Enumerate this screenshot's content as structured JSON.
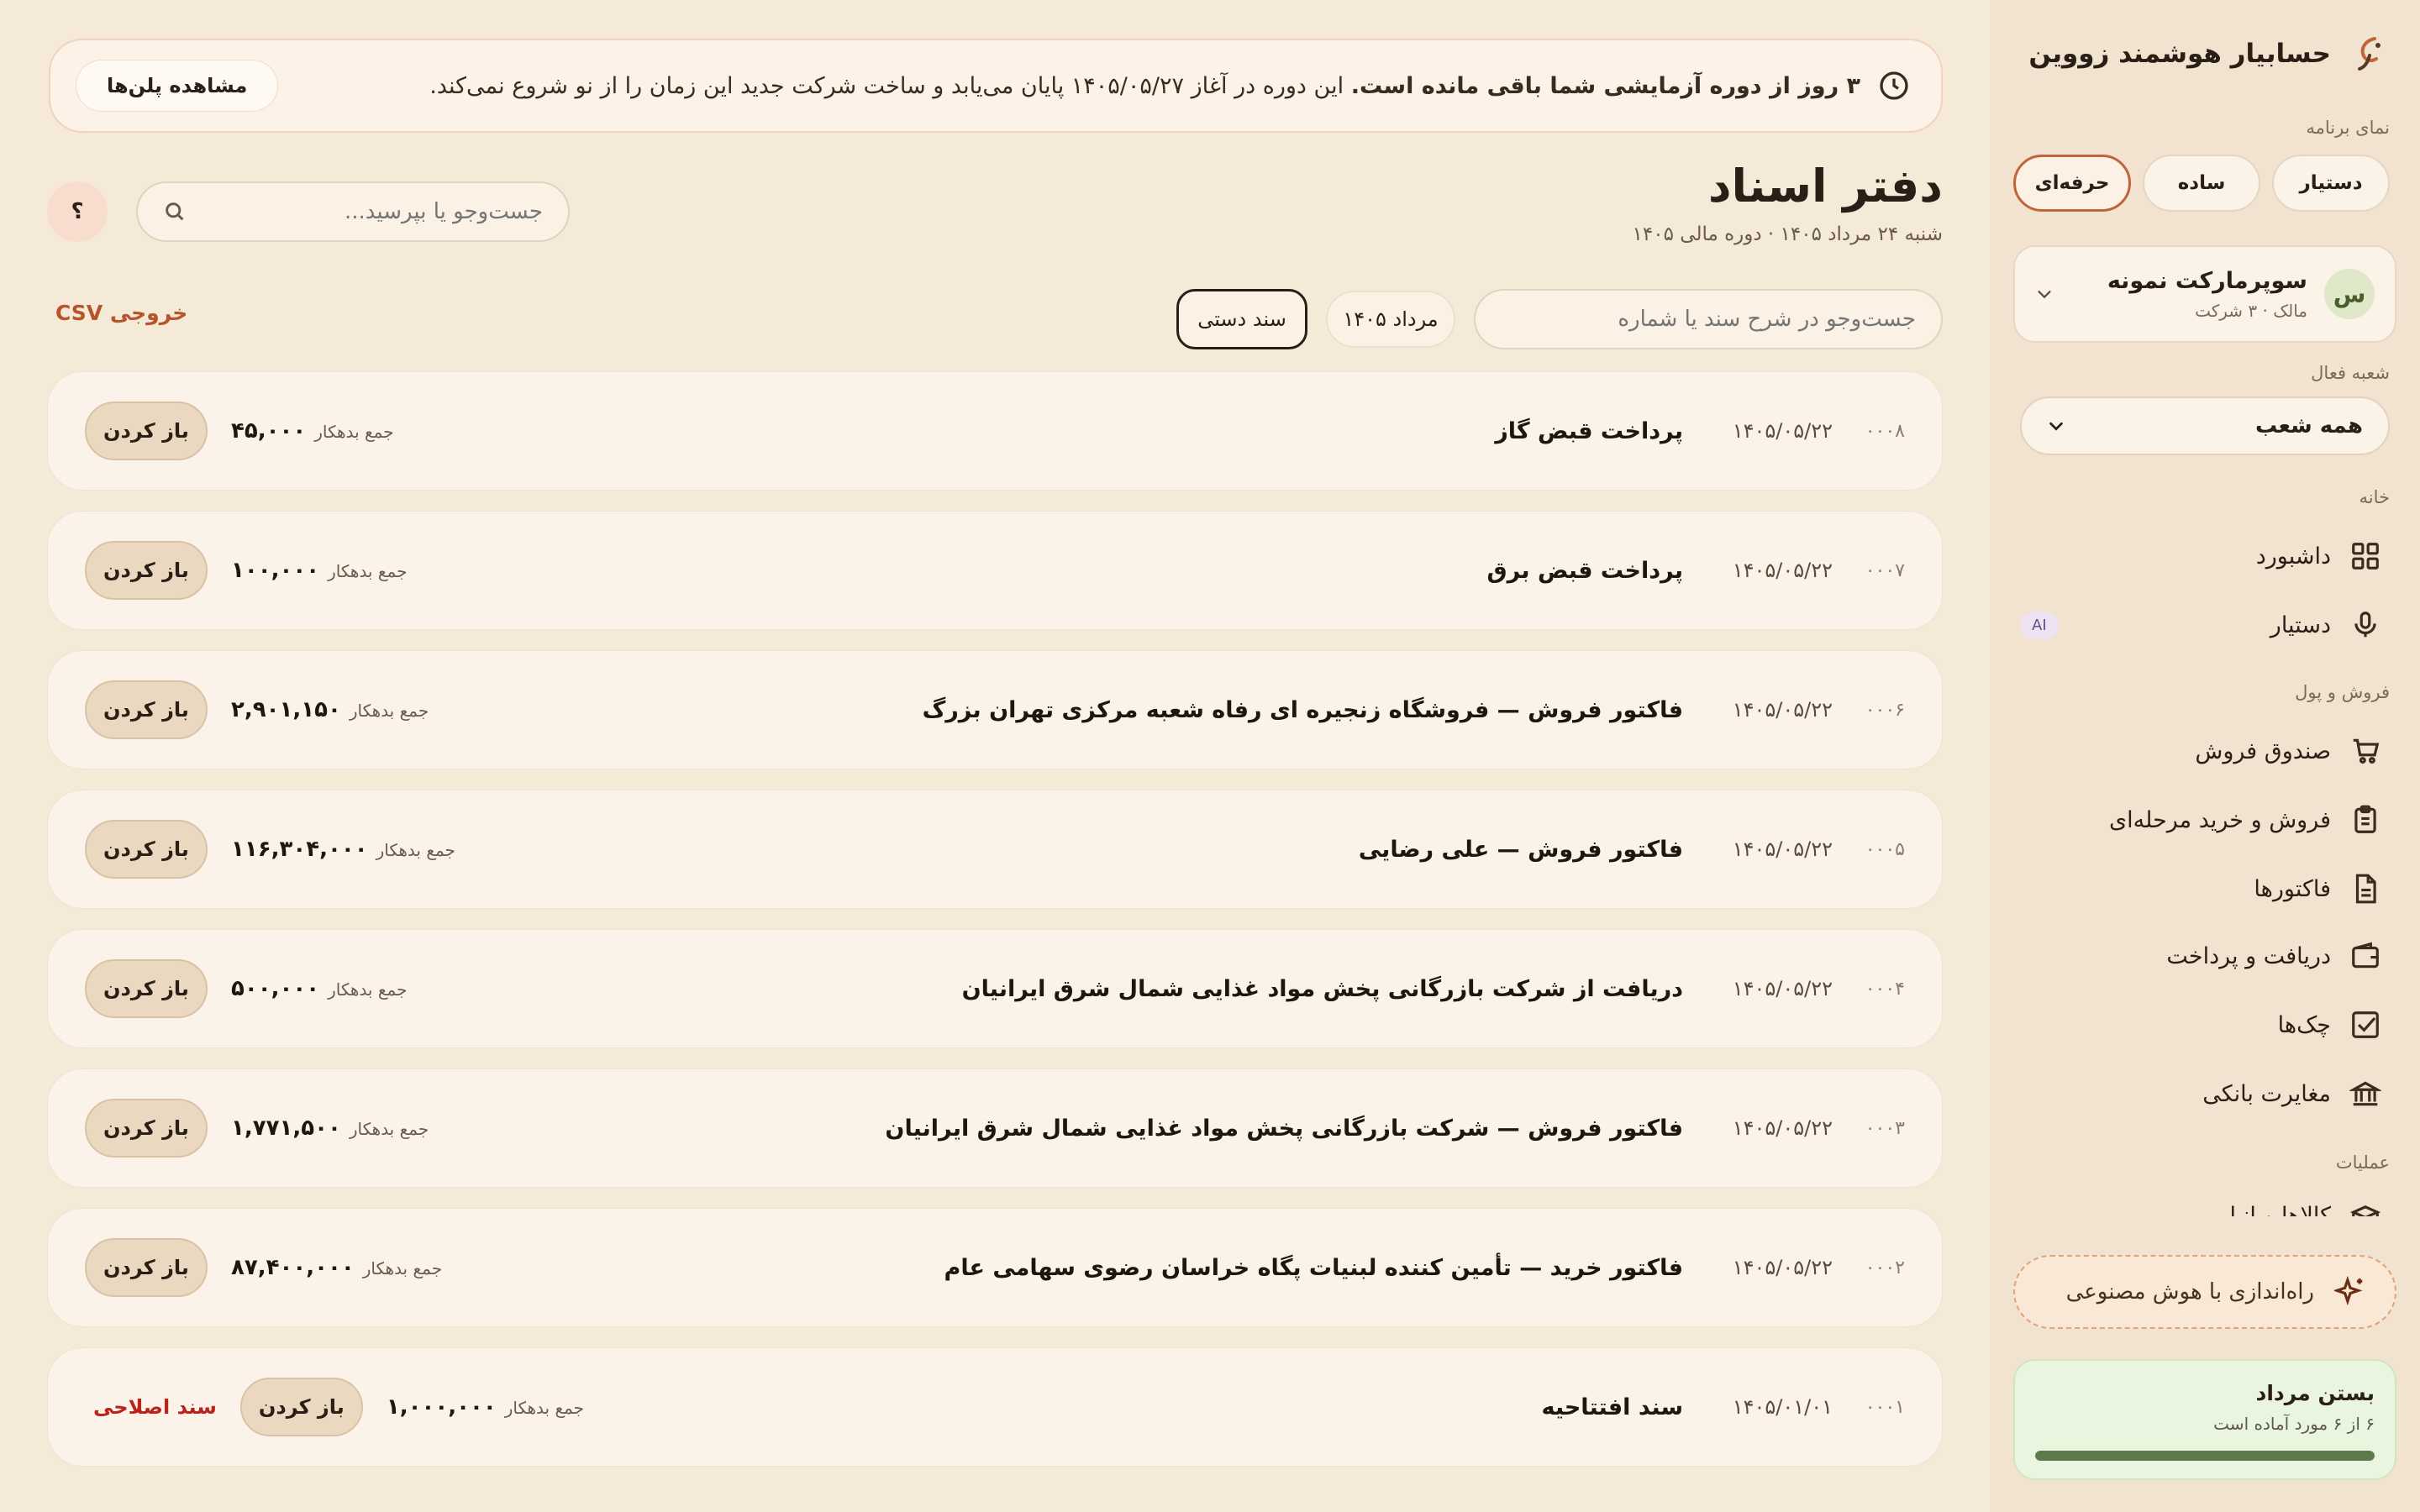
{
  "sidebar": {
    "brand": "حسابیار هوشمند زووین",
    "view_label": "نمای برنامه",
    "modes": [
      "دستیار",
      "ساده",
      "حرفه‌ای"
    ],
    "active_mode": "حرفه‌ای",
    "company": {
      "avatar": "س",
      "name": "سوپرمارکت نمونه",
      "role": "مالک · ۳ شرکت"
    },
    "branch_label": "شعبه فعال",
    "branch_value": "همه شعب",
    "sections": {
      "home": "خانه",
      "sales_money": "فروش و پول",
      "operations": "عملیات"
    },
    "nav": {
      "dashboard": "داشبورد",
      "assistant": "دستیار",
      "assistant_badge": "AI",
      "pos": "صندوق فروش",
      "staged": "فروش و خرید مرحله‌ای",
      "invoices": "فاکتورها",
      "receive_pay": "دریافت و پرداخت",
      "cheques": "چک‌ها",
      "bank_recon": "مغایرت بانکی",
      "goods": "کالاها و انبار"
    },
    "ai_setup": "راه‌اندازی با هوش مصنوعی",
    "close_card": {
      "title": "بستن مرداد",
      "subtitle": "۶ از ۶ مورد آماده است",
      "progress": 1.0
    }
  },
  "banner": {
    "bold": "۳ روز از دوره آزمایشی شما باقی مانده است.",
    "text": " این دوره در آغاز ۱۴۰۵/۰۵/۲۷ پایان می‌یابد و ساخت شرکت جدید این زمان را از نو شروع نمی‌کند.",
    "button": "مشاهده پلن‌ها"
  },
  "header": {
    "title": "دفتر اسناد",
    "subtitle": "شنبه ۲۴ مرداد ۱۴۰۵ · دوره مالی ۱۴۰۵",
    "search_placeholder": "جست‌وجو یا بپرسید...",
    "help": "؟"
  },
  "filters": {
    "search_placeholder": "جست‌وجو در شرح سند یا شماره",
    "period": "مرداد ۱۴۰۵",
    "manual": "سند دستی",
    "csv": "خروجی CSV"
  },
  "docs": {
    "amount_label": "جمع بدهکار",
    "open_label": "باز کردن",
    "correct_label": "سند اصلاحی",
    "rows": [
      {
        "num": "۰۰۰۸",
        "date": "۱۴۰۵/۰۵/۲۲",
        "title": "پرداخت قبض گاز",
        "amount": "۴۵,۰۰۰"
      },
      {
        "num": "۰۰۰۷",
        "date": "۱۴۰۵/۰۵/۲۲",
        "title": "پرداخت قبض برق",
        "amount": "۱۰۰,۰۰۰"
      },
      {
        "num": "۰۰۰۶",
        "date": "۱۴۰۵/۰۵/۲۲",
        "title": "فاکتور فروش — فروشگاه زنجیره ای رفاه شعبه مرکزی تهران بزرگ",
        "amount": "۲,۹۰۱,۱۵۰"
      },
      {
        "num": "۰۰۰۵",
        "date": "۱۴۰۵/۰۵/۲۲",
        "title": "فاکتور فروش — علی رضایی",
        "amount": "۱۱۶,۳۰۴,۰۰۰"
      },
      {
        "num": "۰۰۰۴",
        "date": "۱۴۰۵/۰۵/۲۲",
        "title": "دریافت از شرکت بازرگانی پخش مواد غذایی شمال شرق ایرانیان",
        "amount": "۵۰۰,۰۰۰"
      },
      {
        "num": "۰۰۰۳",
        "date": "۱۴۰۵/۰۵/۲۲",
        "title": "فاکتور فروش — شرکت بازرگانی پخش مواد غذایی شمال شرق ایرانیان",
        "amount": "۱,۷۷۱,۵۰۰"
      },
      {
        "num": "۰۰۰۲",
        "date": "۱۴۰۵/۰۵/۲۲",
        "title": "فاکتور خرید — تأمین کننده لبنیات پگاه خراسان رضوی سهامی عام",
        "amount": "۸۷,۴۰۰,۰۰۰"
      },
      {
        "num": "۰۰۰۱",
        "date": "۱۴۰۵/۰۱/۰۱",
        "title": "سند افتتاحیه",
        "amount": "۱,۰۰۰,۰۰۰"
      }
    ]
  },
  "colors": {
    "accent": "#c0643a",
    "danger": "#b9231b",
    "background": "#f5e9d8"
  }
}
